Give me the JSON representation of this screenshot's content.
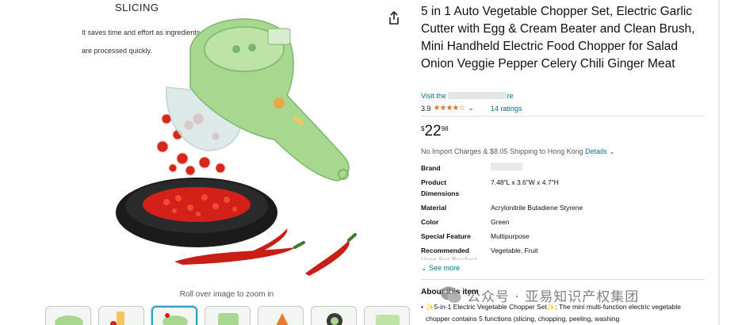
{
  "hero": {
    "caption_title": "SLICING",
    "caption_line1": "It saves time and effort as ingredients",
    "caption_line2": "are processed quickly."
  },
  "share_icon": "share-icon",
  "zoom_hint": "Roll over image to zoom in",
  "thumbnails": [
    {
      "name": "thumb-1"
    },
    {
      "name": "thumb-2"
    },
    {
      "name": "thumb-3",
      "active": true
    },
    {
      "name": "thumb-4"
    },
    {
      "name": "thumb-5"
    },
    {
      "name": "thumb-6"
    },
    {
      "name": "thumb-7"
    }
  ],
  "product": {
    "title": "5 in 1 Auto Vegetable Chopper Set, Electric Garlic Cutter with Egg & Cream Beater and Clean Brush, Mini Handheld Electric Food Chopper for Salad Onion Veggie Pepper Celery Chili Ginger  Meat",
    "store_prefix": "Visit the ",
    "store_suffix": "re",
    "rating_value": "3.9",
    "stars_shown": 3.5,
    "ratings_count": "14 ratings",
    "price_symbol": "$",
    "price_whole": "22",
    "price_fraction": "98",
    "shipping_text": "No Import Charges & $8.05 Shipping to Hong Kong",
    "shipping_details": "Details"
  },
  "specs": [
    {
      "key": "Brand",
      "value": ""
    },
    {
      "key": "Product Dimensions",
      "value": "7.48\"L x 3.6\"W x 4.7\"H"
    },
    {
      "key": "Material",
      "value": "Acrylonitrile Butadiene Styrene"
    },
    {
      "key": "Color",
      "value": "Green"
    },
    {
      "key": "Special Feature",
      "value": "Multipurpose"
    },
    {
      "key": "Recommended",
      "value": "Vegetable, Fruit"
    }
  ],
  "spec_fade": "Uses For Product",
  "see_more": "See more",
  "about": {
    "heading": "About this item",
    "bullet_1": "✨5-in-1 Electric Vegetable Chopper Set✨: The mini multi-function electric vegetable chopper contains 5 functions (slicing, chopping, peeling, washing"
  },
  "watermark": {
    "text": "公众号 · 亚易知识产权集团"
  },
  "colors": {
    "link": "#007185",
    "star": "#de7921",
    "device_green": "#a8d88f",
    "chili_red": "#d3211a"
  }
}
